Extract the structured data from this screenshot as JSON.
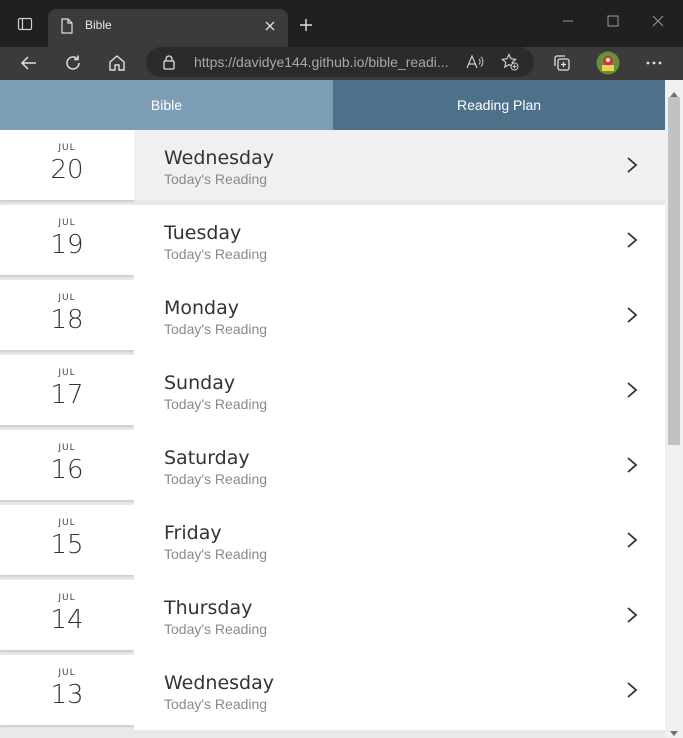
{
  "browser": {
    "tab_title": "Bible",
    "url_host": "https://davidye144.github.io",
    "url_path": "/bible_readi...",
    "icons": {
      "tab_actions": "tab-actions-icon",
      "favicon": "page-icon",
      "close": "close-icon",
      "new_tab": "plus-icon",
      "back": "back-arrow-icon",
      "refresh": "refresh-icon",
      "home": "home-icon",
      "lock": "lock-icon",
      "read_aloud": "read-aloud-icon",
      "favorites": "star-add-icon",
      "collections": "collections-icon",
      "profile": "avatar",
      "menu": "more-icon"
    }
  },
  "tabs": {
    "bible": "Bible",
    "reading_plan": "Reading Plan"
  },
  "readings": [
    {
      "month": "JUL",
      "day": "20",
      "weekday": "Wednesday",
      "subtitle": "Today's Reading",
      "active": true
    },
    {
      "month": "JUL",
      "day": "19",
      "weekday": "Tuesday",
      "subtitle": "Today's Reading",
      "active": false
    },
    {
      "month": "JUL",
      "day": "18",
      "weekday": "Monday",
      "subtitle": "Today's Reading",
      "active": false
    },
    {
      "month": "JUL",
      "day": "17",
      "weekday": "Sunday",
      "subtitle": "Today's Reading",
      "active": false
    },
    {
      "month": "JUL",
      "day": "16",
      "weekday": "Saturday",
      "subtitle": "Today's Reading",
      "active": false
    },
    {
      "month": "JUL",
      "day": "15",
      "weekday": "Friday",
      "subtitle": "Today's Reading",
      "active": false
    },
    {
      "month": "JUL",
      "day": "14",
      "weekday": "Thursday",
      "subtitle": "Today's Reading",
      "active": false
    },
    {
      "month": "JUL",
      "day": "13",
      "weekday": "Wednesday",
      "subtitle": "Today's Reading",
      "active": false
    }
  ],
  "colors": {
    "bible_tab": "#7c9db3",
    "reading_plan_tab": "#4d7189",
    "active_row": "#f0f0f0"
  }
}
